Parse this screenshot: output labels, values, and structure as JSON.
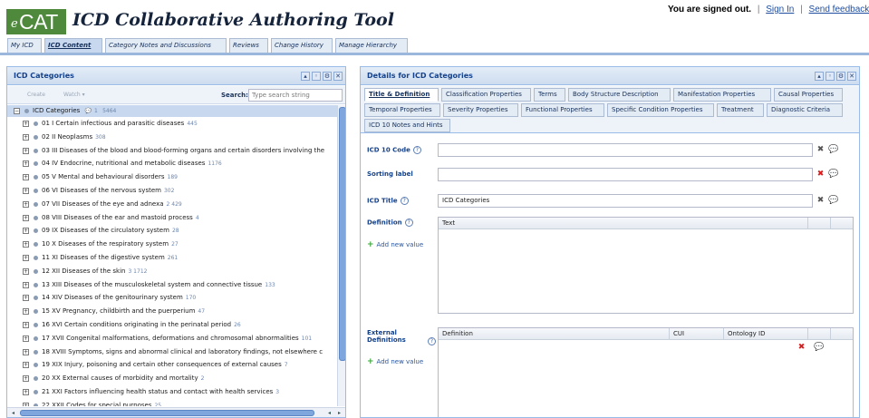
{
  "app": {
    "logo_prefix": "e",
    "logo_text": "CAT",
    "title": "ICD Collaborative Authoring Tool"
  },
  "auth": {
    "status": "You are signed out.",
    "sign_in": "Sign In",
    "separator": "|",
    "feedback": "Send feedback"
  },
  "main_tabs": [
    {
      "label": "My ICD"
    },
    {
      "label": "ICD Content"
    },
    {
      "label": "Category Notes and Discussions"
    },
    {
      "label": "Reviews"
    },
    {
      "label": "Change History"
    },
    {
      "label": "Manage Hierarchy"
    }
  ],
  "left_panel": {
    "title": "ICD Categories",
    "toolbar": {
      "create": "Create",
      "watch": "Watch ▾",
      "search_label": "Search:",
      "search_placeholder": "Type search string"
    },
    "root": {
      "label": "ICD Categories",
      "notes": "1",
      "count": "5464"
    },
    "items": [
      {
        "label": "01 I Certain infectious and parasitic diseases",
        "count": "445"
      },
      {
        "label": "02 II Neoplasms",
        "count": "308"
      },
      {
        "label": "03 III Diseases of the blood and blood-forming organs and certain disorders involving the",
        "count": ""
      },
      {
        "label": "04 IV Endocrine, nutritional and metabolic diseases",
        "count": "1176"
      },
      {
        "label": "05 V Mental and behavioural disorders",
        "count": "189"
      },
      {
        "label": "06 VI Diseases of the nervous system",
        "count": "302"
      },
      {
        "label": "07 VII Diseases of the eye and adnexa",
        "count": "2  429"
      },
      {
        "label": "08 VIII Diseases of the ear and mastoid process",
        "count": "4"
      },
      {
        "label": "09 IX Diseases of the circulatory system",
        "count": "28"
      },
      {
        "label": "10 X Diseases of the respiratory system",
        "count": "27"
      },
      {
        "label": "11 XI Diseases of the digestive system",
        "count": "261"
      },
      {
        "label": "12 XII Diseases of the skin",
        "count": "3  1712"
      },
      {
        "label": "13 XIII Diseases of the musculoskeletal system and connective tissue",
        "count": "133"
      },
      {
        "label": "14 XIV Diseases of the genitourinary system",
        "count": "170"
      },
      {
        "label": "15 XV Pregnancy, childbirth and the puerperium",
        "count": "47"
      },
      {
        "label": "16 XVI Certain conditions originating in the perinatal period",
        "count": "26"
      },
      {
        "label": "17 XVII Congenital malformations, deformations and chromosomal abnormalities",
        "count": "101"
      },
      {
        "label": "18 XVIII Symptoms, signs and abnormal clinical and laboratory findings, not elsewhere c",
        "count": ""
      },
      {
        "label": "19 XIX Injury, poisoning and certain other consequences of external causes",
        "count": "7"
      },
      {
        "label": "20 XX External causes of morbidity and mortality",
        "count": "2"
      },
      {
        "label": "21 XXI Factors influencing health status and contact with health services",
        "count": "3"
      },
      {
        "label": "22 XXII Codes for special purposes",
        "count": "25"
      }
    ]
  },
  "right_panel": {
    "title": "Details for ICD Categories",
    "tabs_row1": [
      "Title & Definition",
      "Classification Properties",
      "Terms",
      "Body Structure Description",
      "Manifestation Properties",
      "Causal Properties"
    ],
    "tabs_row2": [
      "Temporal Properties",
      "Severity Properties",
      "Functional Properties",
      "Specific Condition Properties",
      "Treatment",
      "Diagnostic Criteria"
    ],
    "tabs_row3": [
      "ICD 10 Notes and Hints"
    ],
    "fields": {
      "icd10_code": {
        "label": "ICD 10 Code",
        "value": ""
      },
      "sorting_label": {
        "label": "Sorting label",
        "value": ""
      },
      "icd_title": {
        "label": "ICD Title",
        "value": "ICD Categories"
      }
    },
    "definition": {
      "label": "Definition",
      "column": "Text",
      "add": "Add new value"
    },
    "external": {
      "label": "External Definitions",
      "columns": [
        "Definition",
        "CUI",
        "Ontology ID"
      ],
      "add": "Add new value"
    }
  },
  "colors": {
    "logo_bg": "#4f8a3c",
    "panel_border": "#99bbe8",
    "title_blue": "#15428b"
  }
}
